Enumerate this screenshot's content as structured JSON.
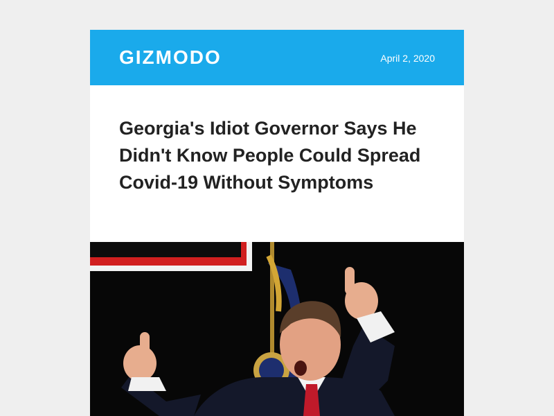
{
  "header": {
    "logo_text": "GIZMODO",
    "date": "April 2, 2020",
    "background_color": "#1aaaeb"
  },
  "article": {
    "headline": "Georgia's Idiot Governor Says He Didn't Know People Could Spread Covid-19 Without Symptoms"
  },
  "image": {
    "icon": "photo-governor-thumbs-up"
  }
}
